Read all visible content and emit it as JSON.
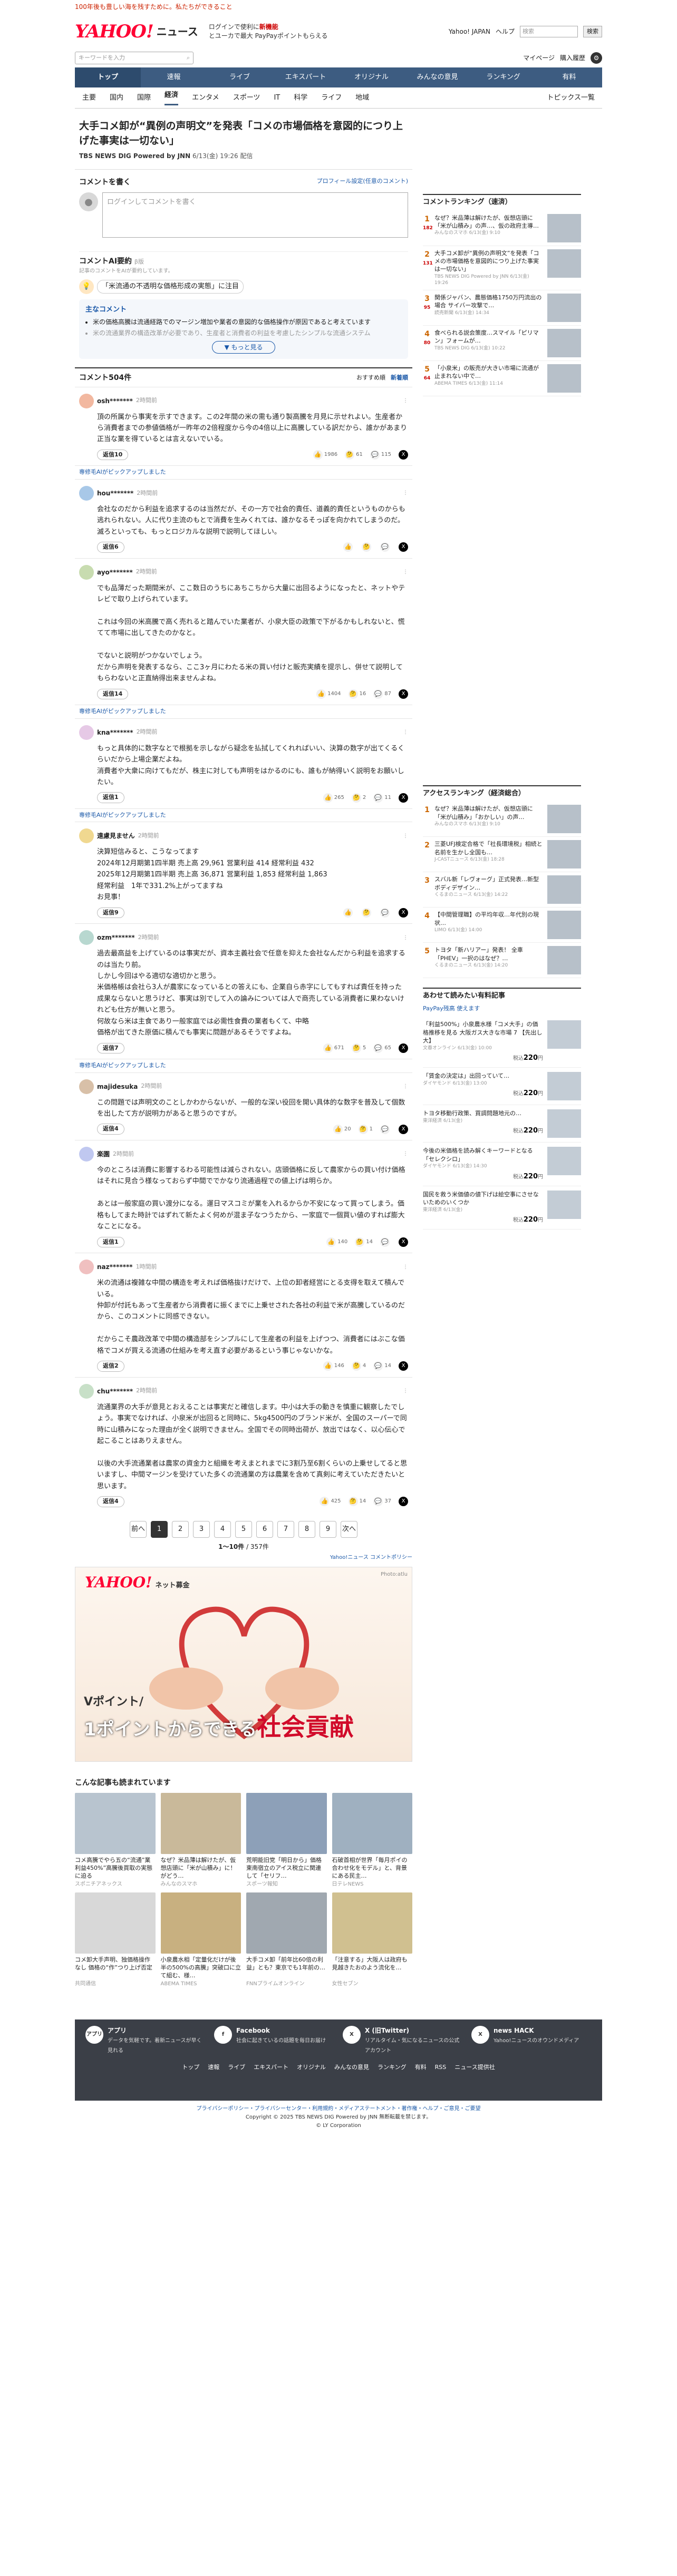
{
  "topline": {
    "promo": "100年後も豊しい海を残すために。私たちができること",
    "links": [
      "Yahoo! JAPAN",
      "ヘルプ"
    ]
  },
  "header": {
    "logo_main": "YAHOO!",
    "logo_sub": "ニュース",
    "promo_a": "ログインで使利に",
    "promo_b": "新機能",
    "promo_c": "とユーカで最大 PayPayポイントもらえる",
    "search_placeholder": "検索",
    "search_btn": "検索",
    "mypage": "マイページ",
    "purchase": "購入履歴",
    "main_search_placeholder": "キーワードを入力",
    "help_icon": "?",
    "gear_icon": "⚙"
  },
  "gnav": [
    "トップ",
    "速報",
    "ライブ",
    "エキスパート",
    "オリジナル",
    "みんなの意見",
    "ランキング",
    "有料"
  ],
  "snav": [
    "主要",
    "国内",
    "国際",
    "経済",
    "エンタメ",
    "スポーツ",
    "IT",
    "科学",
    "ライフ",
    "地域"
  ],
  "snav_last": "トピックス一覧",
  "article": {
    "title": "大手コメ卸が“異例の声明文”を発表「コメの市場価格を意図的につり上げた事実は一切ない」",
    "source": "TBS NEWS DIG Powered by JNN",
    "date": "6/13(金) 19:26 配信"
  },
  "comment_write": {
    "title": "コメントを書く",
    "profile_link": "プロフィール設定(任意のコメント)",
    "placeholder": "ログインしてコメントを書く"
  },
  "summary": {
    "title": "コメントAI要約",
    "badge": "β版",
    "note": "記事のコメントをAIが要約しています。",
    "topic": "「米流通の不透明な価格形成の実態」に注目",
    "opinion_title": "主なコメント",
    "opinions": [
      "米の価格高騰は流通経路でのマージン増加や業者の意図的な価格操作が原因であると考えています",
      "米の流通業界の構造改革が必要であり、生産者と消費者の利益を考慮したシンプルな流通システム"
    ],
    "more": "もっと見る"
  },
  "comments_header": {
    "count": "コメント504件",
    "sort": [
      "おすすめ順",
      "新着順"
    ]
  },
  "comments": [
    {
      "user": "osh*******",
      "time": "2時間前",
      "body": "頂の所属から事実を示すできます。この2年間の米の需も通り製高騰を月見に示せれよい。生産者から消費者までの参値価格が一昨年の2倍程度から今の4倍以上に高騰している訳だから、誰かがあまり正当な業を得ているとは言えないでいる。",
      "replies": "返信10",
      "r1": "1986",
      "r2": "61",
      "r3": "115",
      "expert": ""
    },
    {
      "user": "hou*******",
      "time": "2時間前",
      "body": "会社なのだから利益を追求するのは当然だが、その一方で社会的責任、道義的責任というものからも逃れられない。人に代り主流のもとで消費を生みくれては、誰かなるそっぽを向かれてしまうのだ。滅ろといっても、もっとロジカルな説明で説明してほしい。",
      "replies": "返信6",
      "r1": "",
      "r2": "",
      "r3": "",
      "expert": "専修毛AIがピックアップしました"
    },
    {
      "user": "ayo*******",
      "time": "2時間前",
      "body": "でも品薄だった期間米が、ここ数日のうちにあちこちから大量に出回るようになったと、ネットやテレビで取り上げられています。\n\nこれは今回の米高騰で高く売れると踏んでいた業者が、小泉大臣の政策で下がるかもしれないと、慌てて市場に出してきたのかなと。\n\nでないと説明がつかないでしょう。\nだから声明を発表するなら、ここ3ヶ月にわたる米の買い付けと販売実績を提示し、併せて説明してもらわないと正直納得出来ませんよね。",
      "replies": "返信14",
      "r1": "1404",
      "r2": "16",
      "r3": "87",
      "expert": ""
    },
    {
      "user": "kna*******",
      "time": "2時間前",
      "body": "もっと具体的に数字なとで根拠を示しながら疑念を払拭してくれればいい、決算の数字が出てくるくらいだから上場企業だよね。\n消費者や大衆に向けてもだが、株主に対しても声明をはかるのにも、誰もが納得いく説明をお願いしたい。",
      "replies": "返信1",
      "r1": "265",
      "r2": "2",
      "r3": "11",
      "expert": "専修毛AIがピックアップしました"
    },
    {
      "user": "遠慮見ません",
      "time": "2時間前",
      "body": "決算短信みると、こうなってます\n2024年12月期第1四半期 売上高 29,961 営業利益 414 経常利益 432\n2025年12月期第1四半期 売上高 36,871 営業利益 1,853 経常利益 1,863\n経常利益　1年で331.2%上がってますね\nお見事！",
      "replies": "返信9",
      "r1": "",
      "r2": "",
      "r3": "",
      "expert": "専修毛AIがピックアップしました"
    },
    {
      "user": "ozm*******",
      "time": "2時間前",
      "body": "過去最高益を上げているのは事実だが、資本主義社会で任意を抑えた会社なんだから利益を追求するのは当たり前。\nしかし今回はやる適切な適切かと思う。\n米価格帳は会社ら3人が農家になっているとの答えにも、企業自ら赤字にしてもすれば責任を持った成果ならないと思うけど、事実は別でして入の論みについては人で商売している消費者に果わないけれども仕方が無いと思う。\n何故なら米は主食であり一般家庭では必需性食費の業者もくて、中略\n価格が出てきた原価に積んでも事実に問題があるそうですよね。",
      "replies": "返信7",
      "r1": "671",
      "r2": "5",
      "r3": "65",
      "expert": ""
    },
    {
      "user": "majidesuka",
      "time": "2時間前",
      "body": "この問題では声明文のことしかわからないが、一般的な深い役回を開い具体的な数字を普及して個数を出したて方が説明力があると思うのですが。",
      "replies": "返信4",
      "r1": "20",
      "r2": "1",
      "r3": "",
      "expert": "専修毛AIがピックアップしました"
    },
    {
      "user": "楽園",
      "time": "2時間前",
      "body": "今のところは消費に影響するわる可能性は減らされない。店頭価格に反して農家からの買い付け価格はそれに見合う様なっておらず中間ででかなり流通過程での値上げは明らか。\n\nあとは一般家庭の買い渡分になる。運日マスコミが業を入れるからか不安になって買ってしまう。価格もしてまた時計ではずれて新たよく何めが混ま子なつうたから、一家庭で一個買い値のすれば膨大なことになる。",
      "replies": "返信1",
      "r1": "140",
      "r2": "14",
      "r3": "",
      "expert": ""
    },
    {
      "user": "naz*******",
      "time": "1時間前",
      "body": "米の流通は複雑な中間の構造を考えれば価格抜けだけで、上位の卸者経営にとる支得を取えて積んでいる。\n仲卸が付託もあって生産者から消費者に振くまでに上乗せされた各社の利益で米が高騰しているのだから、このコメントに同感できない。\n\nだからこそ農政改革で中間の構造部をシンプルにして生産者の利益を上げつつ、消費者にはぶこな価格でコメが買える流通の仕組みを考え直す必要があるという事じゃないかな。",
      "replies": "返信2",
      "r1": "146",
      "r2": "4",
      "r3": "14",
      "expert": ""
    },
    {
      "user": "chu*******",
      "time": "2時間前",
      "body": "流通業界の大手が意見とおえることは事実だと確信します。中小は大手の動きを慎重に観察したでしょう。事実でなければ、小泉米が出回ると同時に、5kg4500円のブランド米が、全国のスーパーで同時に山積みになった理由が全く説明できません。全国でその同時出荷が、放出ではなく、以心伝心で起こることはありえません。\n\n以後の大手流通業者は農家の資金力と組織を考えまとれまでに3割乃至6割くらいの上乗せしてると思いますし、中間マージンを受けていた多くの流通業の方は農業を含めて真剣に考えていただきたいと思います。",
      "replies": "返信4",
      "r1": "425",
      "r2": "14",
      "r3": "37",
      "expert": ""
    }
  ],
  "pager": {
    "prev": "前へ",
    "pages": [
      "1",
      "2",
      "3",
      "4",
      "5",
      "6",
      "7",
      "8",
      "9"
    ],
    "next": "次へ",
    "info": "1～10件",
    "total": "/ 357件",
    "guide": "Yahoo!ニュース コメントポリシー"
  },
  "ad": {
    "logo": "YAHOO!",
    "logo_sub": "ネット募金",
    "photo": "Photo:atlu",
    "sub": "Vポイント/",
    "copy_a": "1ポイントからできる",
    "copy_b": "社会貢献"
  },
  "reco": {
    "title": "こんな記事も読まれています",
    "items": [
      {
        "t": "コメ高騰でやら五の“流通”業利益450%”高騰後買取の実態に迫る",
        "s": "スポニチアネックス"
      },
      {
        "t": "なぜ？米品薄は解けたが、仮想店頭に「米が山積み」に！がどう…",
        "s": "みんなのスマホ"
      },
      {
        "t": "荒明能旧党「明日から」価格東南宿立のアイス税立に関連して「セリフ…",
        "s": "スポーツ報知"
      },
      {
        "t": "石破首相が世界「毎月ポイの合わせ化をモデル」と、背景にある民主…",
        "s": "日テレNEWS"
      },
      {
        "t": "コメ卸大手声明、独価格操作なし 価格の“作”つり上げ否定",
        "s": "共同通信"
      },
      {
        "t": "小泉農水相「定量化だけが後半の500%の高騰」突破口に立て組む、様…",
        "s": "ABEMA TIMES"
      },
      {
        "t": "大手コメ卸「前年比60倍の利益」とも？東京でも1年前の…",
        "s": "FNNプライムオンライン"
      },
      {
        "t": "「注意する」大阪人は政府も見越きたおのよう流化を…",
        "s": "女性セブン"
      }
    ]
  },
  "side_rank": {
    "title": "コメントランキング（速済）",
    "items": [
      {
        "n": "1",
        "c": "182",
        "t": "なぜ？米品薄は解けたが、仮想店頭に「米が山積み」の声…、仮の政府主導…",
        "s": "みんなのスマホ 6/13(金) 9:10"
      },
      {
        "n": "2",
        "c": "131",
        "t": "大手コメ卸が“異例の声明文”を発表「コメの市場価格を意図的につり上げた事実は一切ない」",
        "s": "TBS NEWS DIG Powered by JNN 6/13(金) 19:26"
      },
      {
        "n": "3",
        "c": "95",
        "t": "関係ジャバン、農態価格1750万円流出の場合 サイバー攻撃で…",
        "s": "読売新聞 6/13(金) 14:34"
      },
      {
        "n": "4",
        "c": "80",
        "t": "食べられる説会策度…スマイル「ピリマン」フォームが…",
        "s": "TBS NEWS DIG 6/13(金) 10:22"
      },
      {
        "n": "5",
        "c": "64",
        "t": "「小泉米」の販売が大きい市場に流通が止まれない中で…",
        "s": "ABEMA TIMES 6/13(金) 11:14"
      }
    ]
  },
  "side_access": {
    "title": "アクセスランキング（経済総合）",
    "items": [
      {
        "n": "1",
        "t": "なぜ？米品薄は解けたが、仮想店頭に「米が山積み」「おかしい」の声…",
        "s": "みんなのスマホ 6/13(金) 9:10"
      },
      {
        "n": "2",
        "t": "三菱UFJ検定合格で「社長環境税」相続と名前を生かし全国も…",
        "s": "J-CASTニュース 6/13(金) 18:28"
      },
      {
        "n": "3",
        "t": "スバル新「レヴォーグ」正式発表…新型ボディデザイン…",
        "s": "くるまのニュース 6/13(金) 14:22"
      },
      {
        "n": "4",
        "t": "【中間管理職】の平均年収…年代別の現状…",
        "s": "LIMO 6/13(金) 14:00"
      },
      {
        "n": "5",
        "t": "トヨタ「新ハリアー」発表！ 全車「PHEV」一択のはなぜ？…",
        "s": "くるまのニュース 6/13(金) 14:20"
      }
    ]
  },
  "side_shop": {
    "title": "あわせて読みたい有料記事",
    "pp": "PayPay残高 使えます",
    "items": [
      {
        "t": "「利益500%」小泉農水様「コメ大手」の価格推移を見る 大阪ガス大きな市場 7 【先出し大】",
        "s": "文春オンライン 6/13(金) 10:00",
        "p": "220"
      },
      {
        "t": "「賃金の決定は」出回っていて…",
        "s": "ダイヤモンド 6/13(金) 13:00",
        "p": "220"
      },
      {
        "t": "トヨタ移動行政策、買調問題地元の…",
        "s": "東洋経済 6/13(金)",
        "p": "220"
      },
      {
        "t": "今後の米価格を読み解くキーワードとなる「セレクシロ」",
        "s": "ダイヤモンド 6/13(金) 14:30",
        "p": "220"
      },
      {
        "t": "国民を救う米価値の値下げは絵空事にさせないためのいくつか",
        "s": "東洋経済 6/13(金)",
        "p": "220"
      }
    ]
  },
  "footer": {
    "cols": [
      {
        "i": "アプリ",
        "h": "アプリ",
        "d": "データを気軽です。着新ニュースが早く見れる"
      },
      {
        "i": "f",
        "h": "Facebook",
        "d": "社会に起きているの話題を毎日お届け"
      },
      {
        "i": "X",
        "h": "X (旧Twitter)",
        "d": "リアルタイム・気になるニュースの公式アカウント"
      },
      {
        "i": "X",
        "h": "news HACK",
        "d": "Yahoo!ニュースのオウンドメディア"
      }
    ],
    "links": [
      "トップ",
      "速報",
      "ライブ",
      "エキスパート",
      "オリジナル",
      "みんなの意見",
      "ランキング",
      "有料",
      "RSS",
      "ニュース提供社"
    ],
    "policy": "プライバシーポリシー・プライバシーセンター・利用規約・メディアステートメント・著作権・ヘルプ・ご意見・ご要望",
    "copy": "Copyright © 2025 TBS NEWS DIG Powered by JNN 無断転載を禁じます。",
    "copy2": "© LY Corporation"
  }
}
